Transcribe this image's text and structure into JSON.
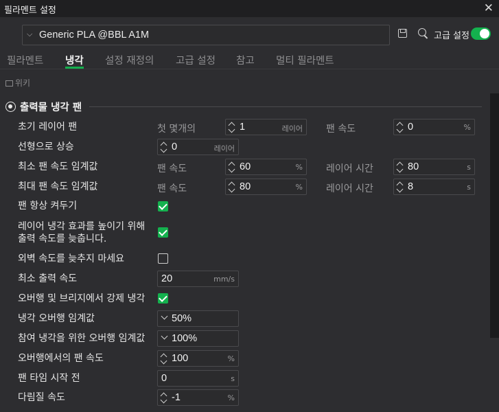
{
  "window": {
    "title": "필라멘트 설정",
    "close": "✕"
  },
  "preset": {
    "value": "Generic PLA @BBL A1M"
  },
  "toolbar": {
    "advanced_label": "고급 설정"
  },
  "tabs": [
    {
      "label": "필라멘트"
    },
    {
      "label": "냉각"
    },
    {
      "label": "설정 재정의"
    },
    {
      "label": "고급 설정"
    },
    {
      "label": "참고"
    },
    {
      "label": "멀티 필라멘트"
    }
  ],
  "wiki": {
    "label": "위키"
  },
  "section": {
    "title": "출력물 냉각 팬"
  },
  "rows": {
    "initial_layer_fan": {
      "label": "초기 레이어 팬",
      "sub1": "첫 몇개의",
      "value1": "1",
      "unit1": "레이어",
      "sub2": "팬 속도",
      "value2": "0",
      "unit2": "%"
    },
    "linear_ramp": {
      "label": "선형으로 상승",
      "value": "0",
      "unit": "레이어"
    },
    "min_fan": {
      "label": "최소 팬 속도 임계값",
      "sub1": "팬 속도",
      "value1": "60",
      "unit1": "%",
      "sub2": "레이어 시간",
      "value2": "80",
      "unit2": "s"
    },
    "max_fan": {
      "label": "최대 팬 속도 임계값",
      "sub1": "팬 속도",
      "value1": "80",
      "unit1": "%",
      "sub2": "레이어 시간",
      "value2": "8",
      "unit2": "s"
    },
    "keep_fan_on": {
      "label": "팬 항상 켜두기",
      "checked": true
    },
    "slow_down": {
      "label_line1": "레이어 냉각 효과를 높이기 위해",
      "label_line2": "출력 속도를 늦춥니다.",
      "checked": true
    },
    "dont_slow_outer": {
      "label": "외벽 속도를 늦추지 마세요",
      "checked": false
    },
    "min_print_speed": {
      "label": "최소 출력 속도",
      "value": "20",
      "unit": "mm/s"
    },
    "force_cooling": {
      "label": "오버행 및 브리지에서 강제 냉각",
      "checked": true
    },
    "cooling_overhang": {
      "label": "냉각 오버행 임계값",
      "value": "50%"
    },
    "overhang_threshold": {
      "label": "참여 냉각을 위한 오버행 임계값",
      "value": "100%"
    },
    "overhang_fan": {
      "label": "오버행에서의 팬 속도",
      "value": "100",
      "unit": "%"
    },
    "fan_kickstart": {
      "label": "팬 타임 시작 전",
      "value": "0",
      "unit": "s"
    },
    "ironing_speed": {
      "label": "다림질 속도",
      "value": "-1",
      "unit": "%"
    }
  },
  "colors": {
    "accent": "#14b14e",
    "background": "#2d2d30"
  }
}
